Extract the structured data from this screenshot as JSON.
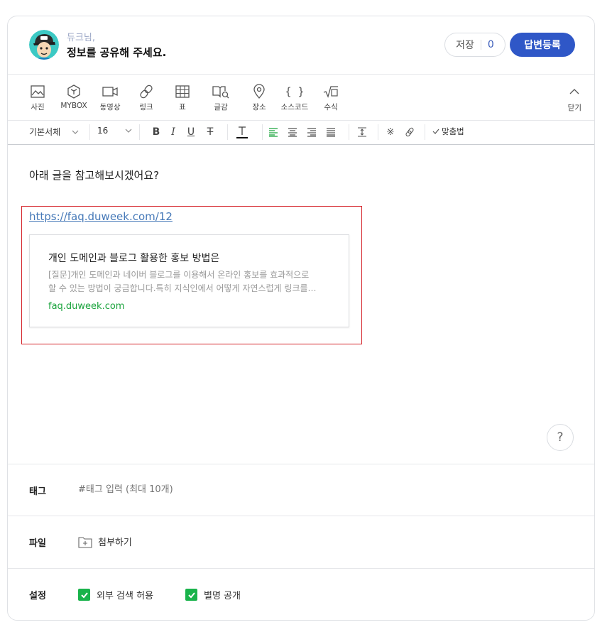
{
  "header": {
    "nickname": "듀크님,",
    "prompt": "정보를 공유해 주세요.",
    "save_label": "저장",
    "save_count": "0",
    "submit_label": "답변등록"
  },
  "toolbar": {
    "items": [
      {
        "label": "사진",
        "icon": "photo-icon"
      },
      {
        "label": "MYBOX",
        "icon": "mybox-icon"
      },
      {
        "label": "동영상",
        "icon": "video-icon"
      },
      {
        "label": "링크",
        "icon": "link-icon"
      },
      {
        "label": "표",
        "icon": "table-icon"
      },
      {
        "label": "글감",
        "icon": "material-icon"
      },
      {
        "label": "장소",
        "icon": "place-icon"
      },
      {
        "label": "소스코드",
        "icon": "code-icon"
      },
      {
        "label": "수식",
        "icon": "formula-icon"
      }
    ],
    "fold_label": "닫기"
  },
  "format": {
    "font_family": "기본서체",
    "font_size": "16",
    "spellcheck_label": "맞춤법"
  },
  "editor": {
    "body_text": "아래 글을 참고해보시겠어요?",
    "link_url": "https://faq.duweek.com/12",
    "og_title": "개인 도메인과 블로그 활용한 홍보 방법은",
    "og_desc_line1": "[질문]개인 도메인과 네이버 블로그를 이용해서 온라인 홍보를 효과적으로",
    "og_desc_line2": "할 수 있는 방법이 궁금합니다.특히 지식인에서 어떻게 자연스럽게 링크를…",
    "og_domain": "faq.duweek.com",
    "help_label": "?"
  },
  "tag": {
    "label": "태그",
    "placeholder": "#태그 입력 (최대 10개)"
  },
  "file": {
    "label": "파일",
    "attach_label": "첨부하기"
  },
  "settings": {
    "label": "설정",
    "options": [
      {
        "label": "외부 검색 허용",
        "checked": true
      },
      {
        "label": "별명 공개",
        "checked": true
      }
    ]
  },
  "colors": {
    "accent": "#2f57c7",
    "link": "#4679b8",
    "domain": "#1aa33c",
    "checkbox": "#19b34b",
    "highlight": "#d5252b"
  }
}
